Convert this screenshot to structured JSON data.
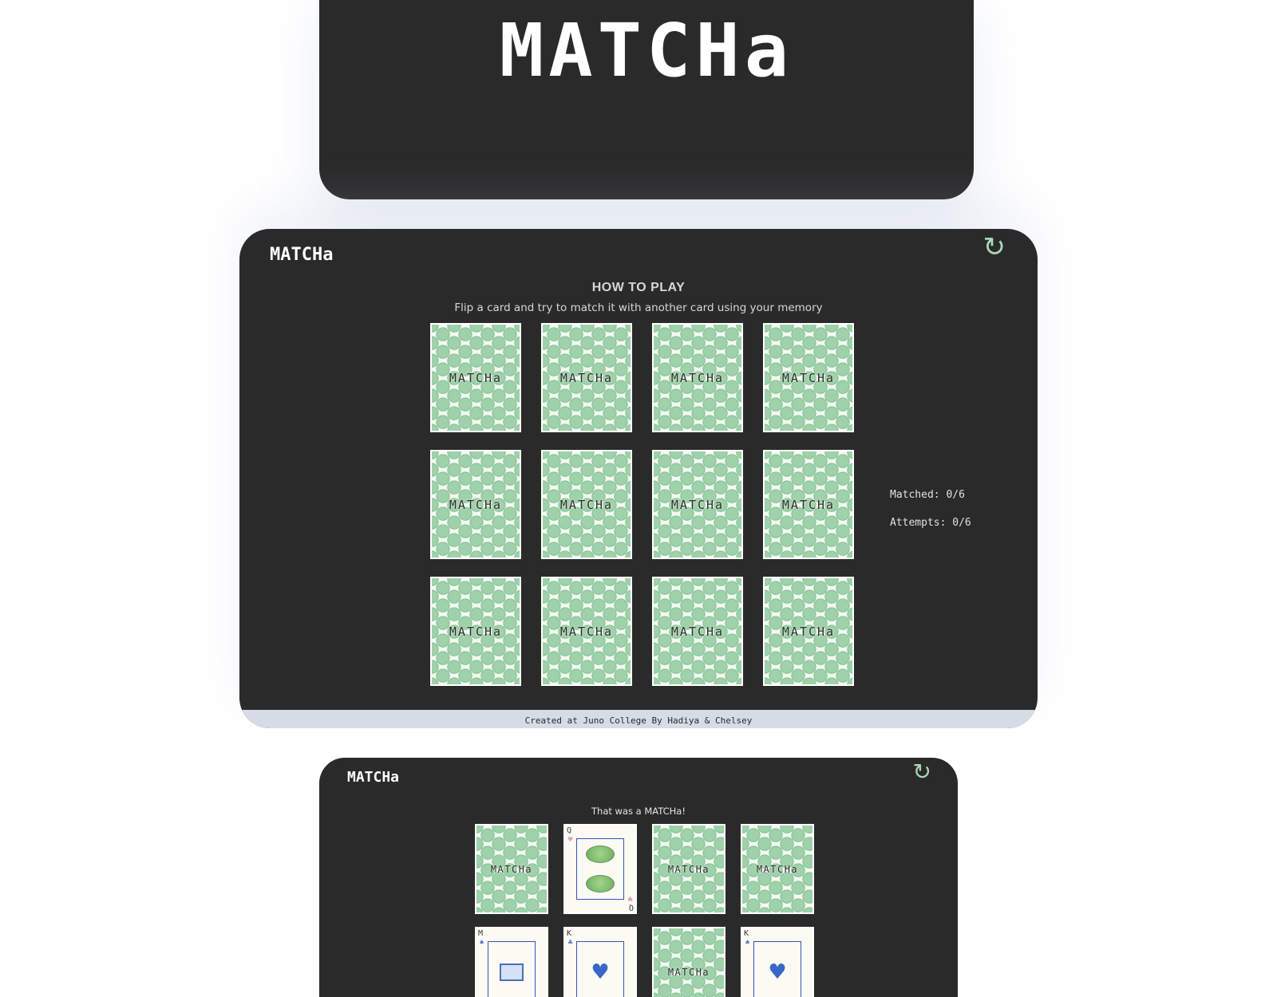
{
  "intro": {
    "title": "MATCHa"
  },
  "game": {
    "logo": "MATCHa",
    "refresh_icon": "↻",
    "instructions_title": "HOW TO PLAY",
    "instructions_text": "Flip a card and try to match it with another card using your memory",
    "card_back_label": "MATCHa",
    "cards": [
      "MATCHa",
      "MATCHa",
      "MATCHa",
      "MATCHa",
      "MATCHa",
      "MATCHa",
      "MATCHa",
      "MATCHa",
      "MATCHa",
      "MATCHa",
      "MATCHa",
      "MATCHa"
    ],
    "stats": {
      "matched": "Matched: 0/6",
      "attempts": "Attempts: 0/6"
    },
    "footer": "Created at Juno College By Hadiya & Chelsey"
  },
  "match_view": {
    "logo": "MATCHa",
    "refresh_icon": "↻",
    "message": "That was a MATCHa!",
    "card_back_label": "MATCHa",
    "face_card_q": {
      "rank": "Q",
      "suit": "♥",
      "suit_color": "#e2a0c0"
    },
    "face_card_m": {
      "rank": "M",
      "suit": "♠"
    },
    "face_card_k1": {
      "rank": "K",
      "suit": "♣"
    },
    "face_card_k2": {
      "rank": "K",
      "suit": "♠"
    },
    "heart_glyph": "♥"
  },
  "colors": {
    "panel_bg": "#2a2a2b",
    "accent_green": "#a8d8b2",
    "footer_bg": "#d7dbe6"
  }
}
